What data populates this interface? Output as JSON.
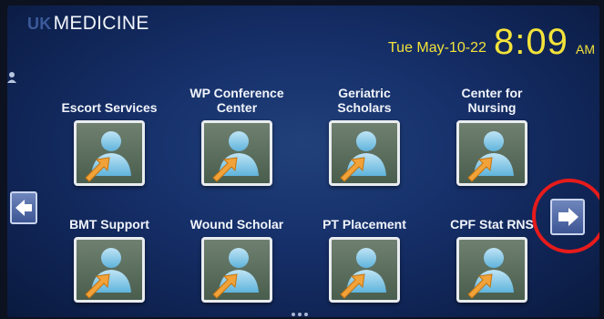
{
  "header": {
    "brand_prefix": "UK",
    "brand_name": "MEDICINE",
    "date": "Tue May-10-22",
    "time": "8:09",
    "ampm": "AM"
  },
  "tiles": [
    {
      "label": "Escort Services",
      "icon": "user-arrow-icon"
    },
    {
      "label": "WP Conference Center",
      "icon": "user-arrow-icon"
    },
    {
      "label": "Geriatric Scholars",
      "icon": "user-arrow-icon"
    },
    {
      "label": "Center for Nursing",
      "icon": "user-arrow-icon"
    },
    {
      "label": "BMT Support",
      "icon": "user-arrow-icon"
    },
    {
      "label": "Wound Scholar",
      "icon": "user-arrow-icon"
    },
    {
      "label": "PT Placement",
      "icon": "user-arrow-icon"
    },
    {
      "label": "CPF Stat RNS",
      "icon": "user-arrow-icon"
    }
  ],
  "navigation": {
    "prev_icon": "arrow-left-icon",
    "next_icon": "arrow-right-icon",
    "page_dots": 3
  },
  "colors": {
    "background": "#16306a",
    "clock": "#f3e33a",
    "highlight_circle": "#e61b1b"
  }
}
